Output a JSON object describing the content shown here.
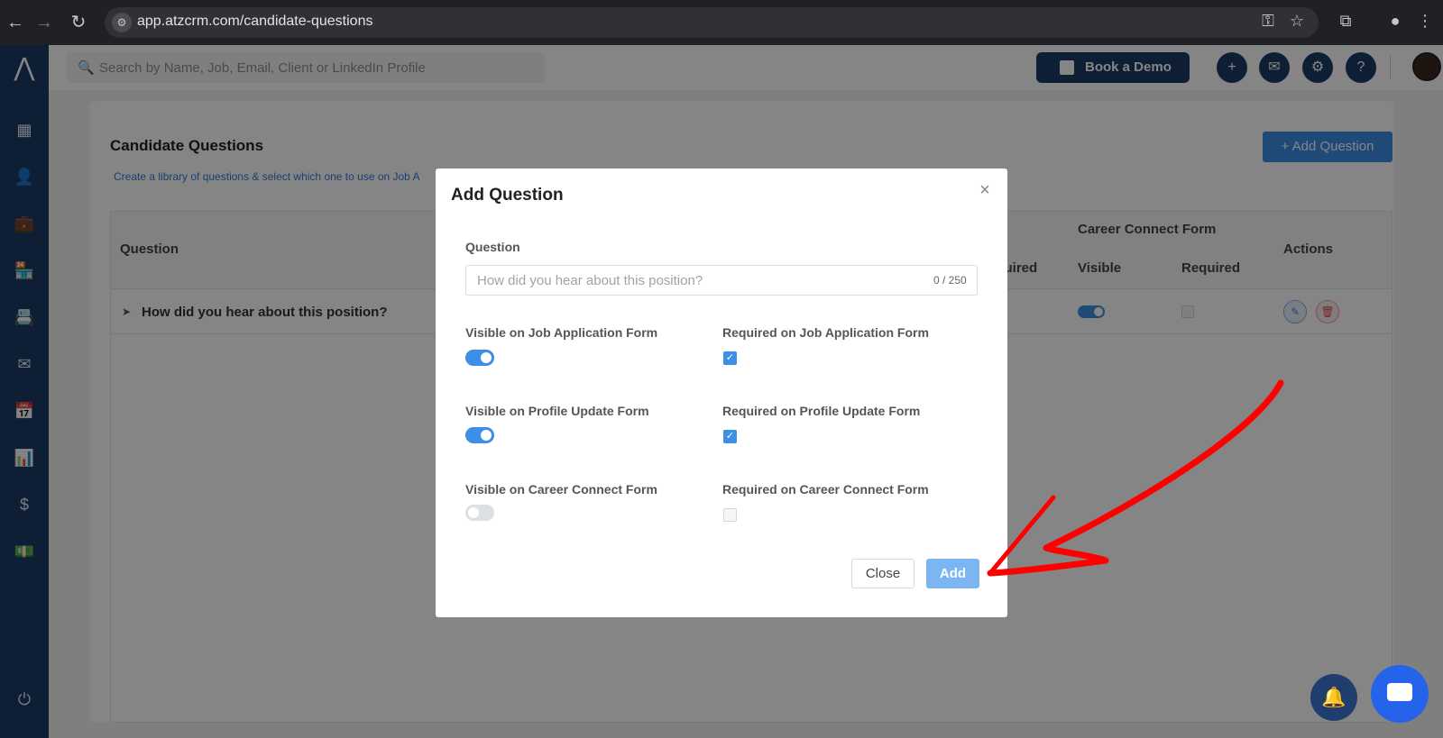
{
  "browser": {
    "url": "app.atzcrm.com/candidate-questions"
  },
  "topbar": {
    "search_placeholder": "Search by Name, Job, Email, Client or LinkedIn Profile",
    "book_demo_label": "Book a Demo"
  },
  "page": {
    "title": "Candidate Questions",
    "subtitle": "Create a library of questions & select which one to use on Job A",
    "add_question_label": "+ Add Question",
    "table": {
      "col_question": "Question",
      "col_group_partial": "m",
      "col_required_partial": "equired",
      "col_group_career": "Career Connect Form",
      "col_visible": "Visible",
      "col_required": "Required",
      "col_actions": "Actions",
      "rows": [
        {
          "question": "How did you hear about this position?",
          "career_visible": true,
          "career_required": false
        }
      ]
    }
  },
  "modal": {
    "title": "Add Question",
    "close_glyph": "×",
    "question_label": "Question",
    "question_placeholder": "How did you hear about this position?",
    "counter": "0 / 250",
    "visible_job_label": "Visible on Job Application Form",
    "required_job_label": "Required on Job Application Form",
    "visible_profile_label": "Visible on Profile Update Form",
    "required_profile_label": "Required on Profile Update Form",
    "visible_career_label": "Visible on Career Connect Form",
    "required_career_label": "Required on Career Connect Form",
    "visible_job": true,
    "required_job": true,
    "visible_profile": true,
    "required_profile": true,
    "visible_career": false,
    "required_career": false,
    "close_button": "Close",
    "add_button": "Add"
  },
  "icons": {
    "back": "arrow-left-icon",
    "forward": "arrow-right-icon",
    "reload": "reload-icon",
    "bell": "bell-icon",
    "chat": "chat-icon"
  },
  "colors": {
    "brand_navy": "#1b3a66",
    "accent_blue": "#3d8ee6",
    "annotation_red": "#ff0000"
  }
}
